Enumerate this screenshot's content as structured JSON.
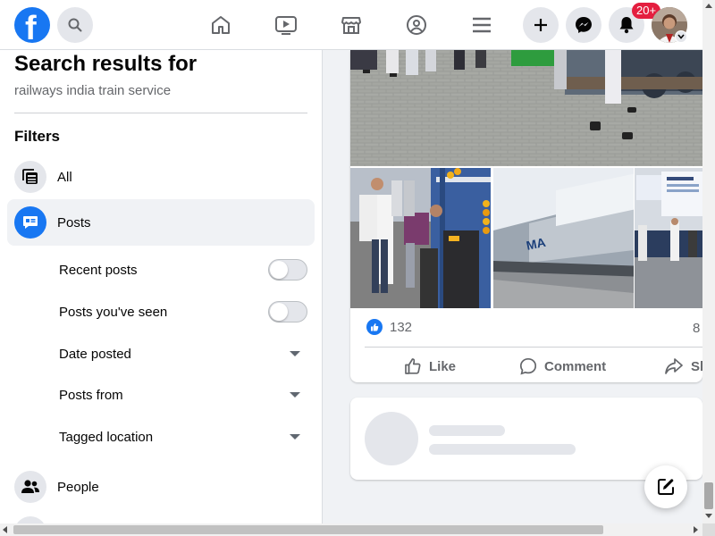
{
  "topbar": {
    "logo_letter": "f",
    "notifications_badge": "20+",
    "icons": [
      "facebook-logo",
      "search-icon",
      "home-icon",
      "watch-icon",
      "marketplace-icon",
      "groups-icon",
      "menu-icon",
      "plus-icon",
      "messenger-icon",
      "bell-icon",
      "profile-avatar"
    ]
  },
  "search": {
    "title": "Search results for",
    "query": "railways india train service"
  },
  "filters": {
    "title": "Filters",
    "items": [
      {
        "label": "All",
        "icon": "feed-icon",
        "active": false
      },
      {
        "label": "Posts",
        "icon": "posts-icon",
        "active": true
      },
      {
        "label": "People",
        "icon": "people-icon",
        "active": false
      }
    ],
    "post_options": [
      {
        "label": "Recent posts",
        "control": "toggle",
        "on": false
      },
      {
        "label": "Posts you've seen",
        "control": "toggle",
        "on": false
      },
      {
        "label": "Date posted",
        "control": "dropdown"
      },
      {
        "label": "Posts from",
        "control": "dropdown"
      },
      {
        "label": "Tagged location",
        "control": "dropdown"
      }
    ]
  },
  "post": {
    "reaction_count": "132",
    "comment_count_partial": "8",
    "actions": {
      "like": "Like",
      "comment": "Comment",
      "share_partial": "Sh"
    }
  },
  "colors": {
    "brand": "#1877f2",
    "badge": "#e41e3f",
    "page_bg": "#f0f2f5"
  }
}
